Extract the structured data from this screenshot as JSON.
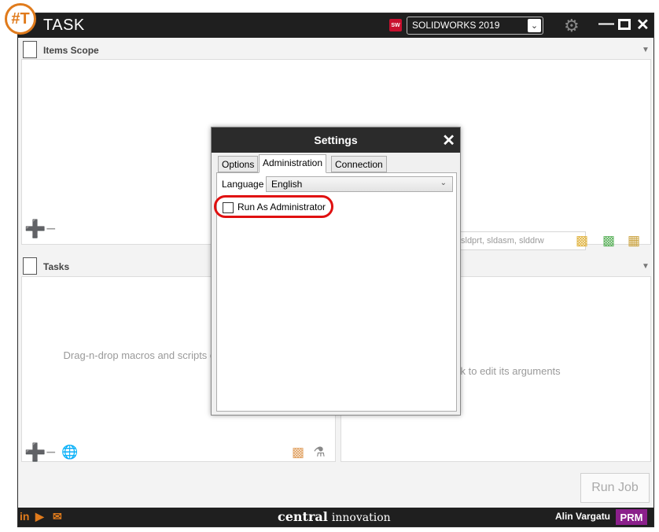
{
  "window": {
    "title": "TASK",
    "app_logo": "#T"
  },
  "toolbar": {
    "sw_badge": "SW",
    "selected_version": "SOLIDWORKS 2019",
    "settings_icon": "gear-icon"
  },
  "items_scope": {
    "title": "Items Scope",
    "filter_placeholder": "sldprt, sldasm, slddrw"
  },
  "tasks": {
    "title": "Tasks",
    "hint": "Drag-n-drop macros and scripts or library"
  },
  "arguments": {
    "hint": "sk to edit its arguments"
  },
  "actions": {
    "run_job": "Run Job"
  },
  "statusbar": {
    "brand_bold": "central",
    "brand_light": "innovation",
    "user_name": "Alin Vargatu",
    "badge": "PRM",
    "social_icons": [
      "linkedin-icon",
      "youtube-icon",
      "mail-icon"
    ]
  },
  "settings_dialog": {
    "title": "Settings",
    "tabs": [
      {
        "label": "Options",
        "active": false
      },
      {
        "label": "Administration",
        "active": true
      },
      {
        "label": "Connection",
        "active": false
      }
    ],
    "language_label": "Language",
    "language_value": "English",
    "run_as_admin_label": "Run As Administrator",
    "run_as_admin_checked": false
  },
  "colors": {
    "accent": "#e07b1c",
    "highlight": "#e01010",
    "badge": "#8b1f8b",
    "titlebar": "#1f1f1f"
  }
}
